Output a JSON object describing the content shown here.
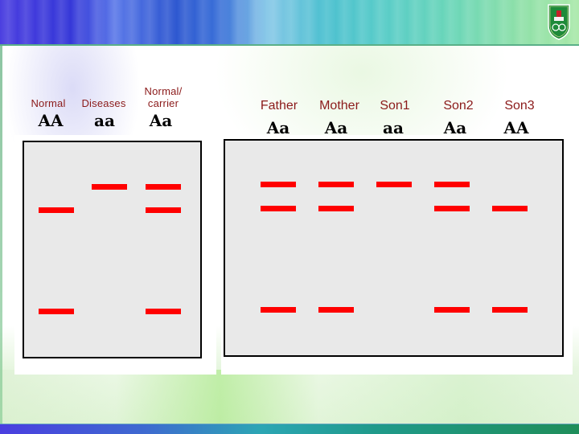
{
  "slide": {
    "header_logo": "university-crest",
    "colors": {
      "band": "#ff0000",
      "gel_background": "#e9e9e9",
      "label_text": "#8b1a1a",
      "genotype_text": "#000000"
    }
  },
  "left_gel": {
    "lanes": [
      {
        "label": "Normal",
        "genotype": "AA",
        "bands": [
          2,
          3
        ]
      },
      {
        "label": "Diseases",
        "genotype": "aa",
        "bands": [
          1
        ]
      },
      {
        "label": "Normal/\ncarrier",
        "label_line1": "Normal/",
        "label_line2": "carrier",
        "genotype": "Aa",
        "bands": [
          1,
          2,
          3
        ]
      }
    ]
  },
  "right_gel": {
    "lanes": [
      {
        "label": "Father",
        "genotype": "Aa",
        "bands": [
          1,
          2,
          3
        ]
      },
      {
        "label": "Mother",
        "genotype": "Aa",
        "bands": [
          1,
          2,
          3
        ]
      },
      {
        "label": "Son1",
        "genotype": "aa",
        "bands": [
          1
        ]
      },
      {
        "label": "Son2",
        "genotype": "Aa",
        "bands": [
          1,
          2,
          3
        ]
      },
      {
        "label": "Son3",
        "genotype": "AA",
        "bands": [
          2,
          3
        ]
      }
    ]
  }
}
